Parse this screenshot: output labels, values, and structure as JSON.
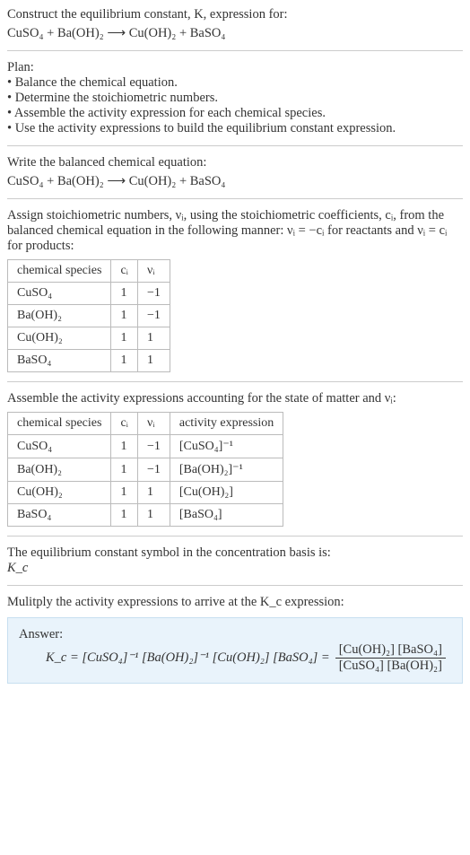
{
  "prompt": "Construct the equilibrium constant, K, expression for:",
  "main_equation": "CuSO₄ + Ba(OH)₂ ⟶ Cu(OH)₂ + BaSO₄",
  "plan_heading": "Plan:",
  "plan_items": [
    "• Balance the chemical equation.",
    "• Determine the stoichiometric numbers.",
    "• Assemble the activity expression for each chemical species.",
    "• Use the activity expressions to build the equilibrium constant expression."
  ],
  "step_balance_text": "Write the balanced chemical equation:",
  "balanced_equation": "CuSO₄ + Ba(OH)₂ ⟶ Cu(OH)₂ + BaSO₄",
  "step_stoich_text_a": "Assign stoichiometric numbers, νᵢ, using the stoichiometric coefficients, cᵢ, from the balanced chemical equation in the following manner: νᵢ = −cᵢ for reactants and νᵢ = cᵢ for products:",
  "table1": {
    "headers": [
      "chemical species",
      "cᵢ",
      "νᵢ"
    ],
    "rows": [
      [
        "CuSO₄",
        "1",
        "−1"
      ],
      [
        "Ba(OH)₂",
        "1",
        "−1"
      ],
      [
        "Cu(OH)₂",
        "1",
        "1"
      ],
      [
        "BaSO₄",
        "1",
        "1"
      ]
    ]
  },
  "step_activity_text": "Assemble the activity expressions accounting for the state of matter and νᵢ:",
  "table2": {
    "headers": [
      "chemical species",
      "cᵢ",
      "νᵢ",
      "activity expression"
    ],
    "rows": [
      [
        "CuSO₄",
        "1",
        "−1",
        "[CuSO₄]⁻¹"
      ],
      [
        "Ba(OH)₂",
        "1",
        "−1",
        "[Ba(OH)₂]⁻¹"
      ],
      [
        "Cu(OH)₂",
        "1",
        "1",
        "[Cu(OH)₂]"
      ],
      [
        "BaSO₄",
        "1",
        "1",
        "[BaSO₄]"
      ]
    ]
  },
  "eq_const_symbol_text": "The equilibrium constant symbol in the concentration basis is:",
  "eq_const_symbol": "K_c",
  "multiply_text": "Mulitply the activity expressions to arrive at the K_c expression:",
  "answer_label": "Answer:",
  "answer_left": "K_c = [CuSO₄]⁻¹ [Ba(OH)₂]⁻¹ [Cu(OH)₂] [BaSO₄] =",
  "answer_frac_num": "[Cu(OH)₂] [BaSO₄]",
  "answer_frac_den": "[CuSO₄] [Ba(OH)₂]"
}
